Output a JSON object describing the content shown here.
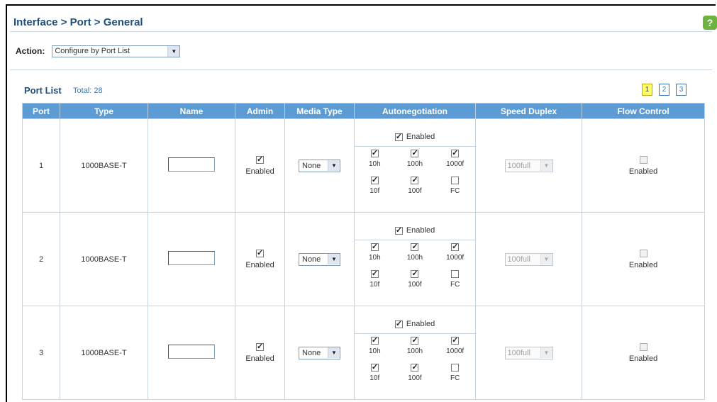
{
  "breadcrumb": "Interface > Port > General",
  "help_icon": "?",
  "action": {
    "label": "Action:",
    "value": "Configure by Port List"
  },
  "port_list": {
    "title": "Port List",
    "total": "Total: 28",
    "pages": [
      "1",
      "2",
      "3"
    ],
    "active_page": "1"
  },
  "columns": [
    "Port",
    "Type",
    "Name",
    "Admin",
    "Media Type",
    "Autonegotiation",
    "Speed Duplex",
    "Flow Control"
  ],
  "rows": [
    {
      "port": "1",
      "type": "1000BASE-T",
      "name": "",
      "admin": "Enabled",
      "media": "None",
      "autoneg_enabled": "Enabled",
      "caps": [
        [
          "10h",
          "100h",
          "1000f"
        ],
        [
          "10f",
          "100f",
          "FC"
        ]
      ],
      "speed": "100full",
      "flow": "Enabled"
    },
    {
      "port": "2",
      "type": "1000BASE-T",
      "name": "",
      "admin": "Enabled",
      "media": "None",
      "autoneg_enabled": "Enabled",
      "caps": [
        [
          "10h",
          "100h",
          "1000f"
        ],
        [
          "10f",
          "100f",
          "FC"
        ]
      ],
      "speed": "100full",
      "flow": "Enabled"
    },
    {
      "port": "3",
      "type": "1000BASE-T",
      "name": "",
      "admin": "Enabled",
      "media": "None",
      "autoneg_enabled": "Enabled",
      "caps": [
        [
          "10h",
          "100h",
          "1000f"
        ],
        [
          "10f",
          "100f",
          "FC"
        ]
      ],
      "speed": "100full",
      "flow": "Enabled"
    }
  ]
}
